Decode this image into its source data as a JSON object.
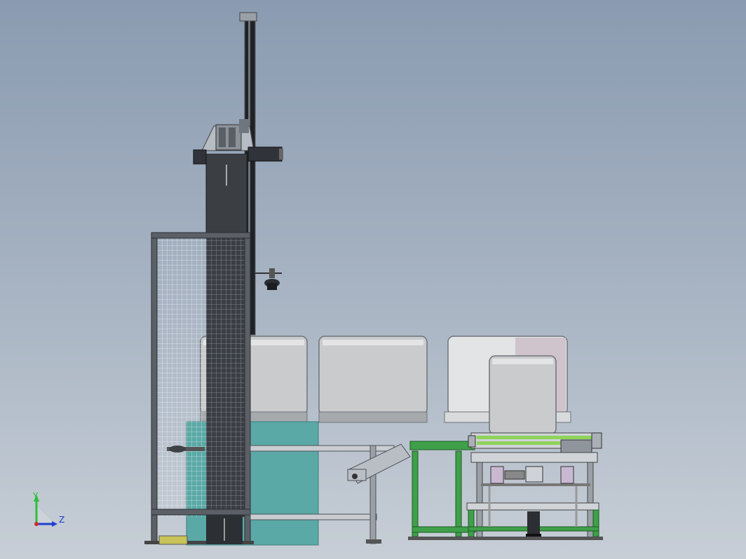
{
  "viewport": {
    "background_top": "#8a9bb1",
    "background_bottom": "#c7ced6"
  },
  "triad": {
    "y_label": "Y",
    "z_label": "Z",
    "y_color": "#2fbf3a",
    "z_color": "#1f3fcf",
    "origin_color": "#d22b2b"
  },
  "colors": {
    "frame_steel": "#4a4f56",
    "column_dark": "#3b3f44",
    "mesh_panel": "#bfc7d1",
    "teal_base": "#5aa9a6",
    "bin_face": "#c9cbcd",
    "bin_light": "#e2e4e6",
    "conveyor_green": "#3fa04a",
    "roller_green": "#8ed35a"
  }
}
